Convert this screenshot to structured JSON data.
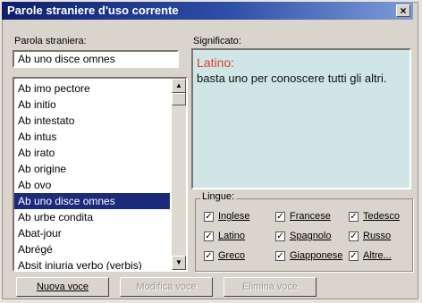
{
  "window": {
    "title": "Parole straniere d'uso corrente",
    "close_glyph": "×"
  },
  "left": {
    "label": "Parola straniera:",
    "input_value": "Ab uno disce omnes",
    "items": [
      "Ab imo pectore",
      "Ab initio",
      "Ab intestato",
      "Ab intus",
      "Ab irato",
      "Ab origine",
      "Ab ovo",
      "Ab uno disce omnes",
      "Ab urbe condita",
      "Abat-jour",
      "Abrégé",
      "Absit iniuria verbo (verbis)"
    ],
    "selected_index": 7
  },
  "meaning": {
    "label": "Significato:",
    "language": "Latino:",
    "text": "basta uno per conoscere tutti gli altri."
  },
  "languages": {
    "title": "Lingue:",
    "items": [
      {
        "label": "Inglese",
        "checked": true
      },
      {
        "label": "Francese",
        "checked": true
      },
      {
        "label": "Tedesco",
        "checked": true
      },
      {
        "label": "Latino",
        "checked": true
      },
      {
        "label": "Spagnolo",
        "checked": true
      },
      {
        "label": "Russo",
        "checked": true
      },
      {
        "label": "Greco",
        "checked": true
      },
      {
        "label": "Giapponese",
        "checked": true
      },
      {
        "label": "Altre...",
        "checked": true
      }
    ]
  },
  "buttons": {
    "new": "Nuova voce",
    "edit": "Modifica voce",
    "delete": "Elimina voce"
  },
  "icons": {
    "scroll_up": "up-arrow",
    "scroll_down": "down-arrow",
    "check": "checkmark"
  }
}
